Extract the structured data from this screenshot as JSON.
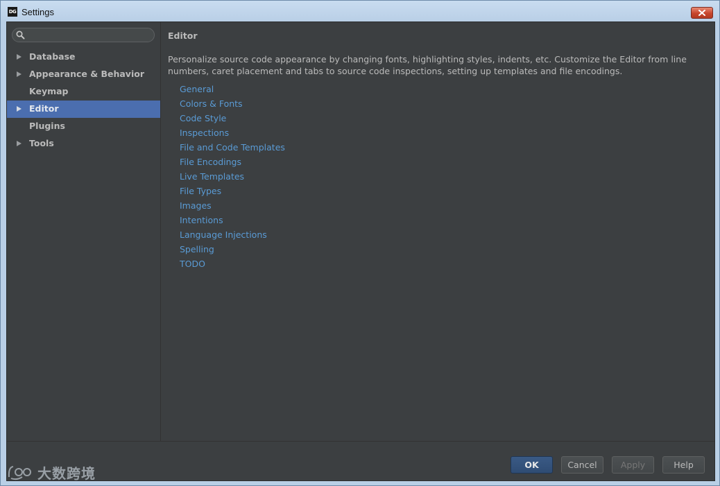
{
  "window": {
    "title": "Settings",
    "icon_text": "DG"
  },
  "search": {
    "value": "",
    "placeholder": ""
  },
  "sidebar": {
    "items": [
      {
        "label": "Database",
        "expandable": true,
        "selected": false
      },
      {
        "label": "Appearance & Behavior",
        "expandable": true,
        "selected": false
      },
      {
        "label": "Keymap",
        "expandable": false,
        "selected": false
      },
      {
        "label": "Editor",
        "expandable": true,
        "selected": true
      },
      {
        "label": "Plugins",
        "expandable": false,
        "selected": false
      },
      {
        "label": "Tools",
        "expandable": true,
        "selected": false
      }
    ]
  },
  "content": {
    "title": "Editor",
    "description": "Personalize source code appearance by changing fonts, highlighting styles, indents, etc. Customize the Editor from line numbers, caret placement and tabs to source code inspections, setting up templates and file encodings.",
    "links": [
      "General",
      "Colors & Fonts",
      "Code Style",
      "Inspections",
      "File and Code Templates",
      "File Encodings",
      "Live Templates",
      "File Types",
      "Images",
      "Intentions",
      "Language Injections",
      "Spelling",
      "TODO"
    ]
  },
  "buttons": {
    "ok": "OK",
    "cancel": "Cancel",
    "apply": "Apply",
    "help": "Help"
  },
  "watermark": {
    "text": "大数跨境"
  },
  "colors": {
    "background": "#3c3f41",
    "selection": "#4b6eaf",
    "link": "#5a9bd5",
    "text": "#bbbbbb"
  }
}
